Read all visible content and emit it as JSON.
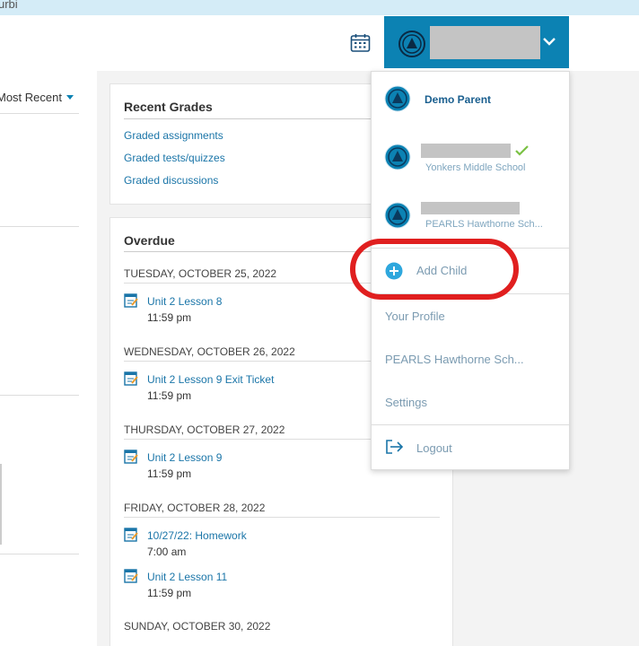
{
  "banner": {
    "text": "urbi"
  },
  "header": {
    "calendar_icon": "calendar-icon",
    "account_chevron": "chevron-down-icon"
  },
  "left": {
    "sort_label": "Most Recent"
  },
  "recent_grades": {
    "title": "Recent Grades",
    "links": [
      "Graded assignments",
      "Graded tests/quizzes",
      "Graded discussions"
    ]
  },
  "overdue": {
    "title": "Overdue",
    "groups": [
      {
        "date": "TUESDAY, OCTOBER 25, 2022",
        "items": [
          {
            "title": "Unit 2 Lesson 8",
            "time": "11:59 pm"
          }
        ]
      },
      {
        "date": "WEDNESDAY, OCTOBER 26, 2022",
        "items": [
          {
            "title": "Unit 2 Lesson 9 Exit Ticket",
            "time": "11:59 pm"
          }
        ]
      },
      {
        "date": "THURSDAY, OCTOBER 27, 2022",
        "items": [
          {
            "title": "Unit 2 Lesson 9",
            "time": "11:59 pm"
          }
        ]
      },
      {
        "date": "FRIDAY, OCTOBER 28, 2022",
        "items": [
          {
            "title": "10/27/22: Homework",
            "time": "7:00 am"
          },
          {
            "title": "Unit 2 Lesson 11",
            "time": "11:59 pm"
          }
        ]
      },
      {
        "date": "SUNDAY, OCTOBER 30, 2022",
        "items": []
      }
    ]
  },
  "dropdown": {
    "parent_name": "Demo Parent",
    "child1_school": "Yonkers Middle School",
    "child2_school": "PEARLS Hawthorne Sch...",
    "add_child": "Add Child",
    "your_profile": "Your Profile",
    "school_link": "PEARLS Hawthorne Sch...",
    "settings": "Settings",
    "logout": "Logout"
  },
  "colors": {
    "accent": "#0c82b3",
    "highlight": "#e01f1f",
    "check": "#7ac143"
  }
}
